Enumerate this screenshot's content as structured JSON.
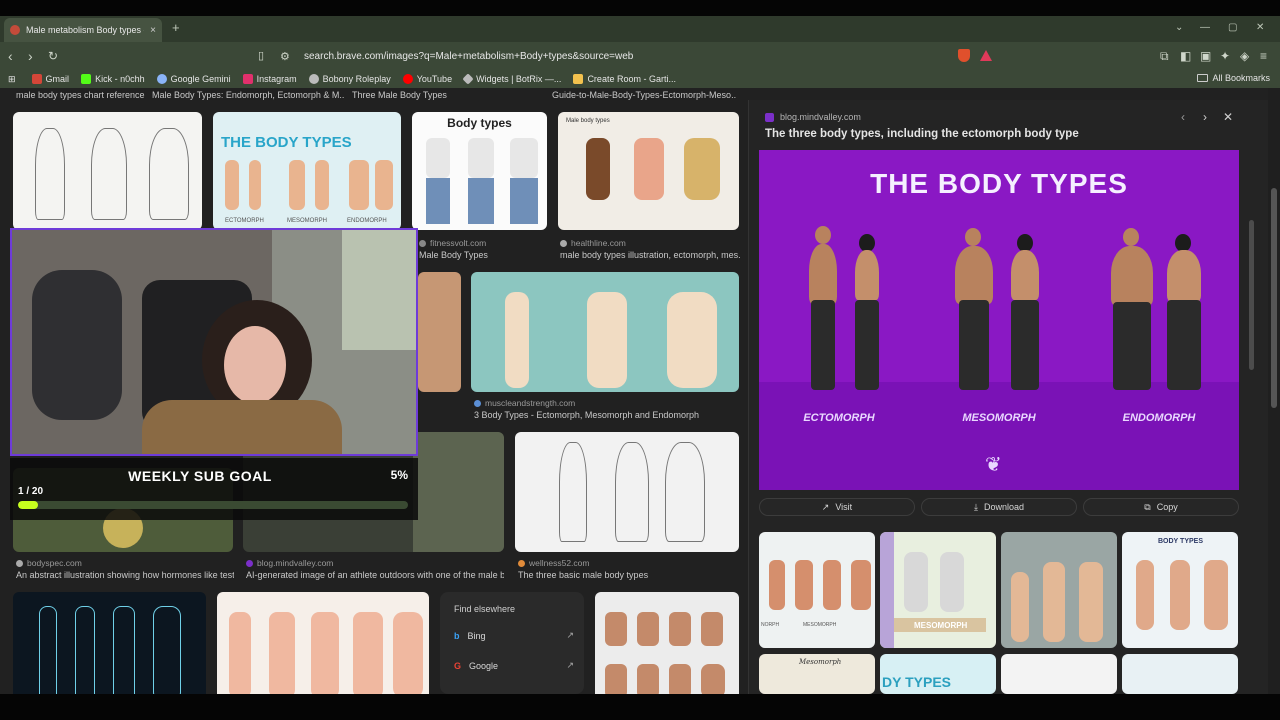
{
  "browser": {
    "tab_title": "Male metabolism Body types - B",
    "tab_close": "×",
    "new_tab": "+",
    "url": "search.brave.com/images?q=Male+metabolism+Body+types&source=web",
    "bookmarks": [
      {
        "label": "Gmail",
        "color": "#d44638"
      },
      {
        "label": "Kick - n0chh",
        "color": "#53fc18"
      },
      {
        "label": "Google Gemini",
        "color": "#8ab4f8"
      },
      {
        "label": "Instagram",
        "color": "#e1306c"
      },
      {
        "label": "Bobony Roleplay",
        "color": "#bbbbbb"
      },
      {
        "label": "YouTube",
        "color": "#ff0000"
      },
      {
        "label": "Widgets | BotRix —...",
        "color": "#bbbbbb"
      },
      {
        "label": "Create Room - Garti...",
        "color": "#f2c14e"
      }
    ],
    "all_bookmarks": "All Bookmarks"
  },
  "results": {
    "top_captions": [
      "male body types chart reference",
      "Male Body Types: Endomorph, Ectomorph & M...",
      "Three Male Body Types",
      "Guide-to-Male-Body-Types-Ectomorph-Meso..."
    ],
    "row1": [
      {
        "site": "fitnessvolt.com",
        "caption": "Male Body Types"
      },
      {
        "site": "healthline.com",
        "caption": "male body types illustration, ectomorph, mes..."
      }
    ],
    "row2": [
      {
        "site": "muscleandstrength.com",
        "caption": "3 Body Types - Ectomorph, Mesomorph and Endomorph"
      }
    ],
    "row3": [
      {
        "site": "bodyspec.com",
        "caption": "An abstract illustration showing how hormones like test..."
      },
      {
        "site": "blog.mindvalley.com",
        "caption": "AI-generated image of an athlete outdoors with one of the male b..."
      },
      {
        "site": "wellness52.com",
        "caption": "The three basic male body types"
      }
    ],
    "thumb_text": {
      "body_types_blue": "THE BODY TYPES",
      "body_types_white": "Body types",
      "male_body_types_small": "Male body types",
      "ecto": "ECTOMORPH",
      "meso": "MESOMORPH",
      "endo": "ENDOMORPH"
    },
    "find_elsewhere": {
      "title": "Find elsewhere",
      "items": [
        "Bing",
        "Google"
      ]
    }
  },
  "panel": {
    "site": "blog.mindvalley.com",
    "title": "The three body types, including the ectomorph body type",
    "hero_title": "THE BODY TYPES",
    "labels": [
      "ECTOMORPH",
      "MESOMORPH",
      "ENDOMORPH"
    ],
    "buttons": {
      "visit": "Visit",
      "download": "Download",
      "copy": "Copy"
    },
    "related_text": {
      "body_types": "BODY TYPES",
      "dy_types": "DY TYPES",
      "mesomorph": "MESOMORPH",
      "norph": "NORPH",
      "mesomorph_small": "MESOMORPH",
      "mesomorph_script": "Mesomorph"
    }
  },
  "overlay": {
    "goal_title": "WEEKLY SUB GOAL",
    "goal_percent": "5%",
    "goal_count": "1 / 20",
    "goal_progress": 0.05
  },
  "colors": {
    "accent_purple": "#8a18c4",
    "goal_fill": "#c6ff1e",
    "webcam_border": "#6e3bd8"
  }
}
